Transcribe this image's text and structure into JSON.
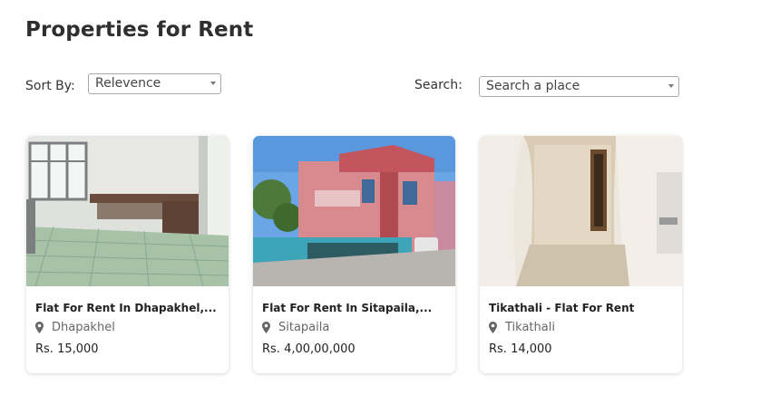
{
  "page": {
    "title": "Properties for Rent"
  },
  "filters": {
    "sort_label": "Sort By:",
    "sort_value": "Relevence",
    "search_label": "Search:",
    "search_placeholder": "Search a place"
  },
  "listings": [
    {
      "title": "Flat For Rent In Dhapakhel,...",
      "location": "Dhapakhel",
      "price": "Rs. 15,000",
      "image": "kitchen-room-photo"
    },
    {
      "title": "Flat For Rent In Sitapaila,...",
      "location": "Sitapaila",
      "price": "Rs. 4,00,00,000",
      "image": "pink-house-exterior-photo"
    },
    {
      "title": "Tikathali - Flat For Rent",
      "location": "Tikathali",
      "price": "Rs. 14,000",
      "image": "empty-room-arch-photo"
    }
  ]
}
